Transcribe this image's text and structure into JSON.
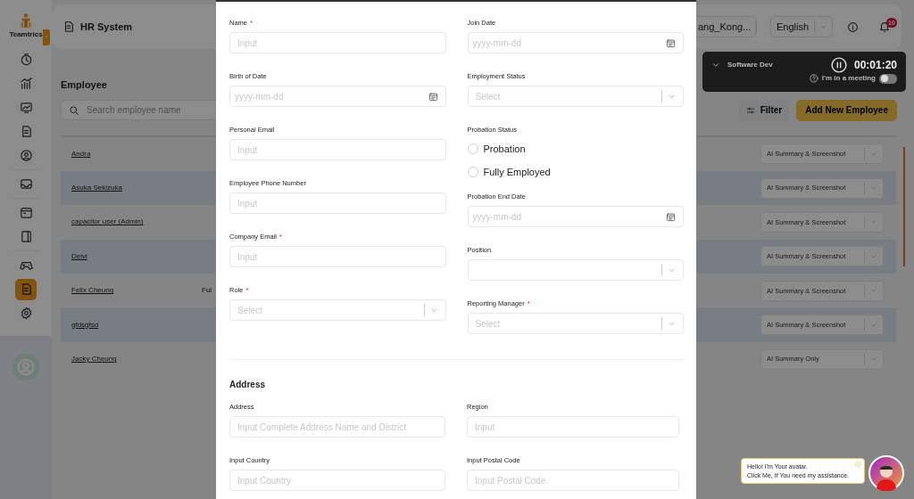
{
  "sidebar": {
    "logo_text": "Teamtrics",
    "toggle_label": "›",
    "items": [
      {
        "selected": false
      },
      {
        "selected": false
      },
      {
        "selected": false
      },
      {
        "selected": false
      },
      {
        "selected": false
      },
      {
        "selected": false
      },
      {
        "selected": false
      },
      {
        "selected": false
      },
      {
        "selected": false
      },
      {
        "selected": true
      },
      {
        "selected": false
      }
    ]
  },
  "header": {
    "title": "HR System",
    "timezone": "ang_Kong...",
    "language": "English",
    "notification_count": "10"
  },
  "timer": {
    "project": "Software Dev",
    "time": "00:01:20",
    "meeting_label": "I'm in a meeting",
    "meeting_on": false
  },
  "page": {
    "title": "Employee",
    "search_placeholder": "Search employee name",
    "filter_label": "Filter",
    "add_label": "Add New Employee"
  },
  "rows": [
    {
      "name": "Andra",
      "summary": "AI Summary & Screenshot"
    },
    {
      "name": "Asuka Sekizuka",
      "summary": "AI Summary & Screenshot"
    },
    {
      "name": "capacitor user (Admin)",
      "summary": "AI Summary & Screenshot"
    },
    {
      "name": "Delvi",
      "summary": "AI Summary & Screenshot"
    },
    {
      "name": "Felix Cheung",
      "column_2": "Ful",
      "summary": "AI Summary & Screenshot"
    },
    {
      "name": "gfdsgfsd",
      "summary": "AI Summary & Screenshot"
    },
    {
      "name": "Jacky Cheung",
      "summary": "AI Summary Only"
    }
  ],
  "modal": {
    "required_mark": "*",
    "left_fields": [
      {
        "kind": "text",
        "label": "Name",
        "required": true,
        "placeholder": "Input"
      },
      {
        "kind": "date",
        "label": "Birth of Date",
        "required": false,
        "placeholder": "yyyy-mm-dd"
      },
      {
        "kind": "text",
        "label": "Personal Email",
        "required": false,
        "placeholder": "Input"
      },
      {
        "kind": "text",
        "label": "Employee Phone Number",
        "required": false,
        "placeholder": "Input"
      },
      {
        "kind": "text",
        "label": "Company Email",
        "required": true,
        "placeholder": "Input"
      },
      {
        "kind": "select",
        "label": "Role",
        "required": true,
        "placeholder": "Select"
      }
    ],
    "right_fields": [
      {
        "kind": "date",
        "label": "Join Date",
        "required": false,
        "placeholder": "yyyy-mm-dd"
      },
      {
        "kind": "select",
        "label": "Employment Status",
        "required": false,
        "placeholder": "Select"
      },
      {
        "kind": "radio",
        "label": "Probation Status",
        "required": false,
        "options": [
          {
            "label": "Probation",
            "selected": false
          },
          {
            "label": "Fully Employed",
            "selected": false
          }
        ]
      },
      {
        "kind": "date",
        "label": "Probation End Date",
        "required": false,
        "placeholder": "yyyy-mm-dd"
      },
      {
        "kind": "select",
        "label": "Position",
        "required": false
      },
      {
        "kind": "select",
        "label": "Reporting Manager",
        "required": true,
        "placeholder": "Select"
      }
    ],
    "address_heading": "Address",
    "address_fields": [
      {
        "kind": "text",
        "label": "Address",
        "required": false,
        "placeholder": "Input Complete Address Name and District"
      },
      {
        "kind": "text",
        "label": "Region",
        "required": false,
        "placeholder": "Input"
      },
      {
        "kind": "text",
        "label": "Input Country",
        "required": false,
        "placeholder": "Input Country"
      },
      {
        "kind": "text",
        "label": "Input Postal Code",
        "required": false,
        "placeholder": "Input Postal Code"
      }
    ]
  },
  "assistant": {
    "lines": [
      "Hello! I'm Your avatar.",
      "Click Me, If You need my assistance."
    ]
  }
}
